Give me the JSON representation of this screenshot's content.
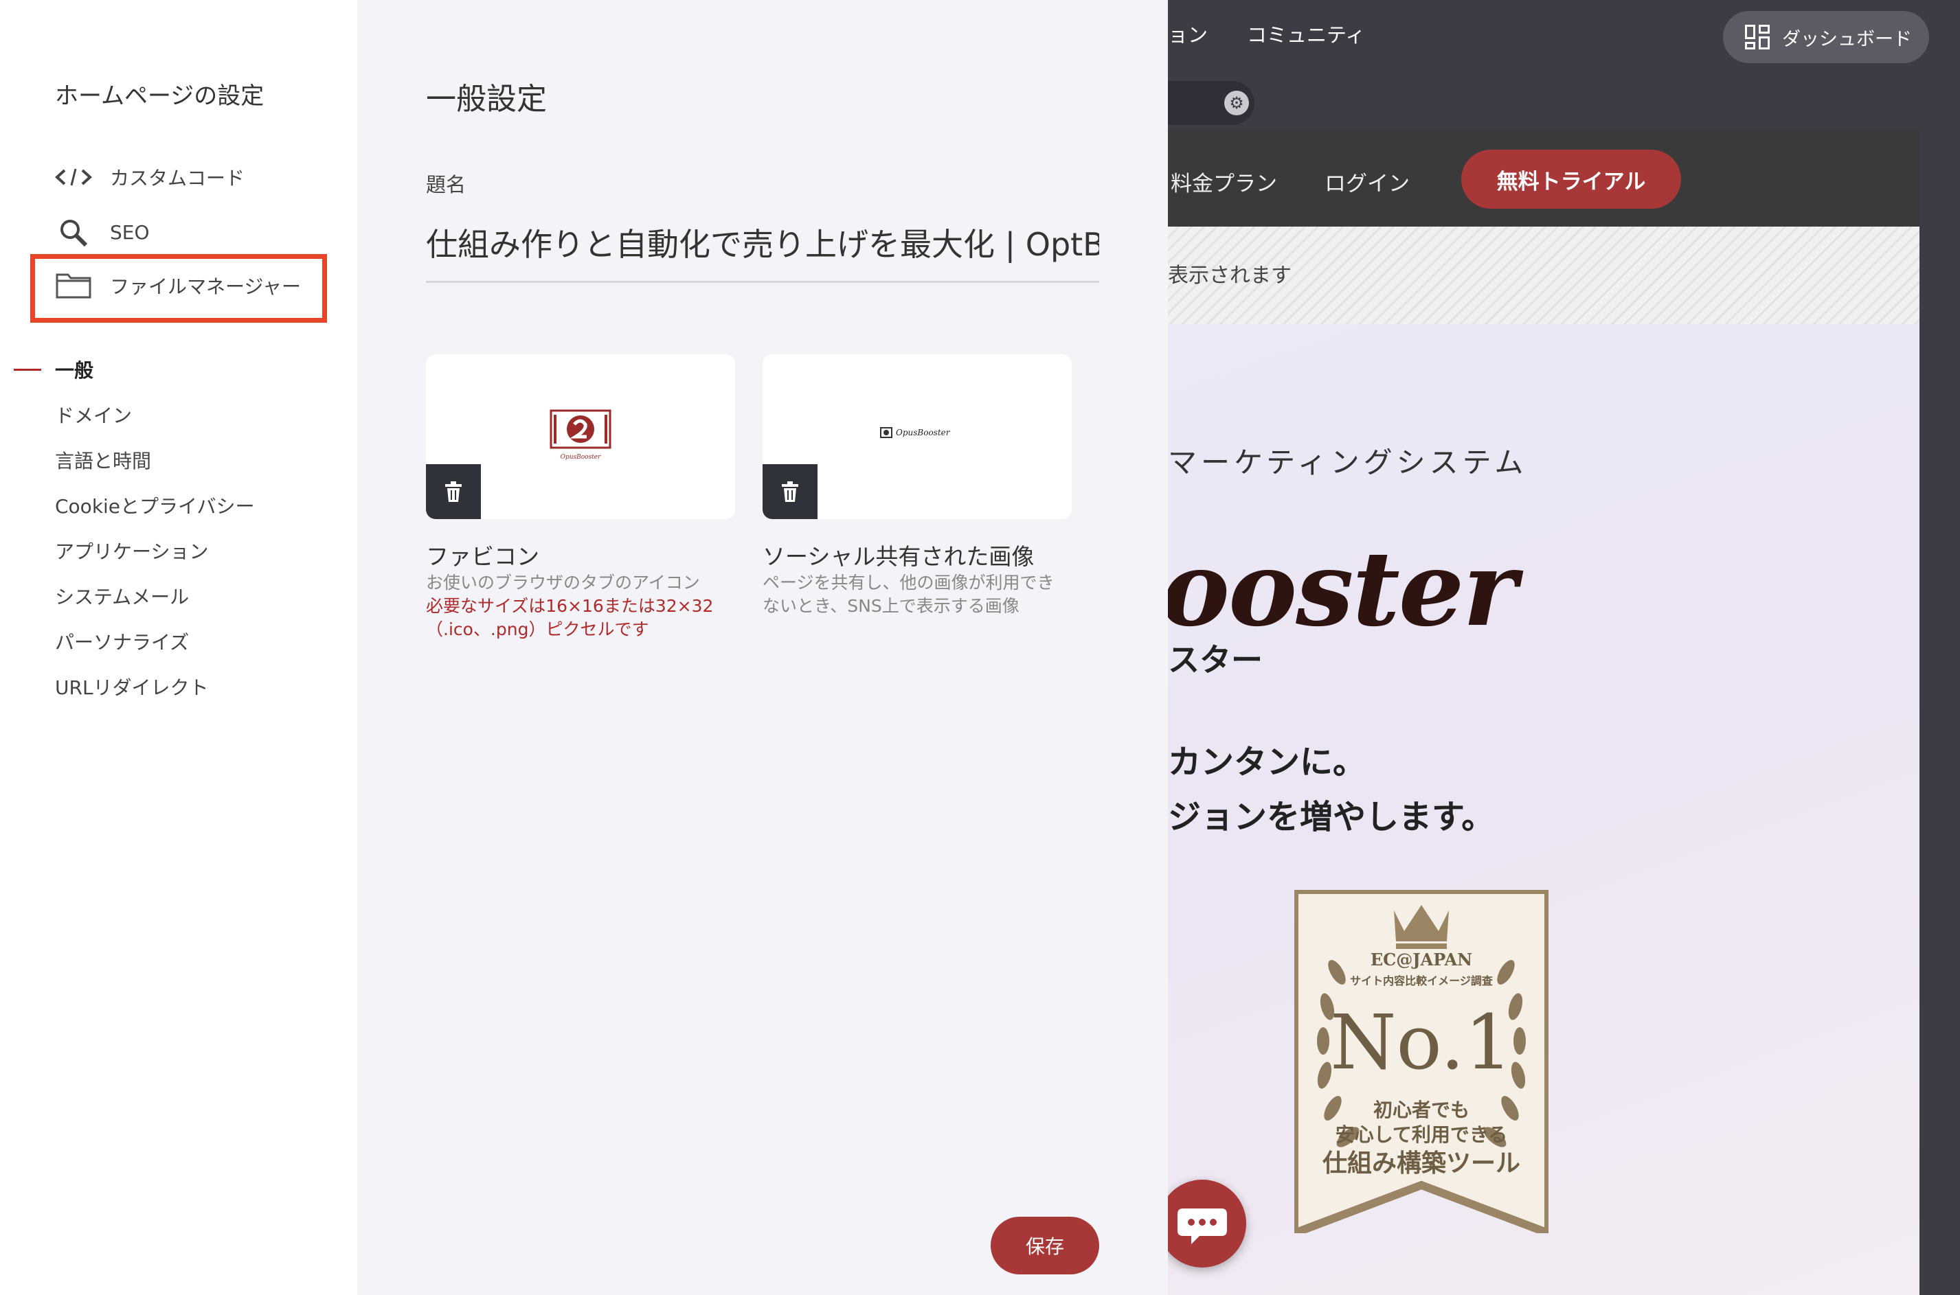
{
  "colors": {
    "accent": "#a83838",
    "highlight": "#e8442a",
    "dark": "#3b3c44"
  },
  "preview": {
    "topnav": {
      "partial_link": "ョン",
      "community": "コミュニティ",
      "dashboard": "ダッシュボード"
    },
    "site_header": {
      "plans": "料金プラン",
      "login": "ログイン",
      "trial": "無料トライアル"
    },
    "hatch_text": "表示されます",
    "subtitle": "マーケティングシステム",
    "logo_text": "ooster",
    "logo_kana": "スター",
    "line1": "カンタンに。",
    "line2": "ジョンを増やします。",
    "badge": {
      "org": "EC@JAPAN",
      "survey": "サイト内容比較イメージ調査",
      "rank": "No.1",
      "text1": "初心者でも",
      "text2": "安心して利用できる",
      "text3": "仕組み構築ツール"
    }
  },
  "sidebar": {
    "title": "ホームページの設定",
    "tools": [
      {
        "label": "カスタムコード",
        "icon": "code-icon"
      },
      {
        "label": "SEO",
        "icon": "search-icon"
      },
      {
        "label": "ファイルマネージャー",
        "icon": "folder-icon"
      }
    ],
    "items": [
      {
        "label": "一般"
      },
      {
        "label": "ドメイン"
      },
      {
        "label": "言語と時間"
      },
      {
        "label": "Cookieとプライバシー"
      },
      {
        "label": "アプリケーション"
      },
      {
        "label": "システムメール"
      },
      {
        "label": "パーソナライズ"
      },
      {
        "label": "URLリダイレクト"
      }
    ]
  },
  "panel": {
    "title": "一般設定",
    "field_label": "題名",
    "field_value": "仕組み作りと自動化で売り上げを最大化 | OptBooster",
    "cards": [
      {
        "title": "ファビコン",
        "desc": "お使いのブラウザのタブのアイコン",
        "warn1": "必要なサイズは16×16または32×32",
        "warn2": "（.ico、.png）ピクセルです",
        "thumb_caption": "OpusBooster"
      },
      {
        "title": "ソーシャル共有された画像",
        "desc1": "ページを共有し、他の画像が利用でき",
        "desc2": "ないとき、SNS上で表示する画像",
        "thumb_text": "OpusBooster"
      }
    ],
    "save": "保存"
  }
}
